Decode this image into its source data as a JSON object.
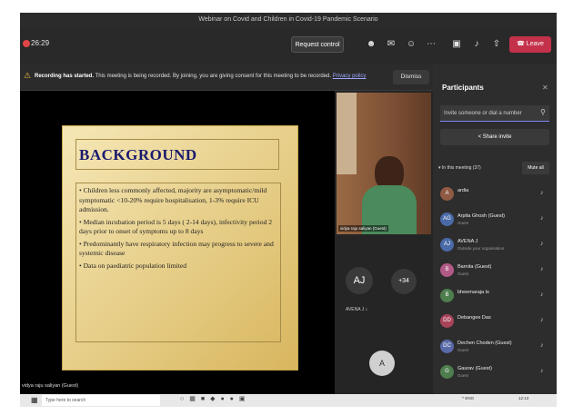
{
  "window": {
    "title": "Webinar on Covid and Children in Covid-19 Pandemic Scenario"
  },
  "toolbar": {
    "timer": "26:29",
    "request_control": "Request control",
    "icons": [
      "people-icon",
      "chat-icon",
      "reactions-icon",
      "more-icon",
      "camera-icon",
      "mic-icon",
      "share-icon"
    ],
    "leave_label": "Leave",
    "leave_color": "#c4314b"
  },
  "banner": {
    "bold": "Recording has started.",
    "text": "This meeting is being recorded. By joining, you are giving consent for this meeting to be recorded.",
    "link": "Privacy policy",
    "dismiss": "Dismiss"
  },
  "slide": {
    "title": "BACKGROUND",
    "bullets": [
      "Children less commonly affected, majority are asymptomatic/mild symptomatic <10-20% require hospitalisation, 1-3% require ICU admission.",
      "Median incubation period is 5 days ( 2-14 days), infectivity period 2 days prior to onset of symptoms up to 8 days",
      "Predominantly have respiratory infection may progress to severe and systemic disease",
      "Data on paediatric population limited"
    ],
    "presenter": "vidya raju saliyan (Guest)"
  },
  "gallery": {
    "camera_name": "vidya raju saliyan (Guest)",
    "aj_initials": "AJ",
    "aj_name": "AVENA J",
    "more_count": "+34",
    "a_initial": "A"
  },
  "participants": {
    "title": "Participants",
    "invite_placeholder": "Invite someone or dial a number",
    "share_invite": "Share invite",
    "section_label": "In this meeting (37)",
    "mute_all": "Mute all",
    "list": [
      {
        "initials": "A",
        "name": "ardia",
        "sub": "",
        "color": "#8f5a44"
      },
      {
        "initials": "AG",
        "name": "Arpita Ghosh (Guest)",
        "sub": "Guest",
        "color": "#4a6aa8"
      },
      {
        "initials": "AJ",
        "name": "AVENA J",
        "sub": "Outside your organisation",
        "color": "#4a6aa8"
      },
      {
        "initials": "B",
        "name": "Barnita (Guest)",
        "sub": "Guest",
        "color": "#b25a86"
      },
      {
        "initials": "B",
        "name": "bheemaraja ts",
        "sub": "",
        "color": "#4e7e4e"
      },
      {
        "initials": "DD",
        "name": "Debangee Das",
        "sub": "",
        "color": "#a8445a"
      },
      {
        "initials": "DC",
        "name": "Dechen Choden (Guest)",
        "sub": "Guest",
        "color": "#5a6aa8"
      },
      {
        "initials": "G",
        "name": "Gaurav (Guest)",
        "sub": "Guest",
        "color": "#4e7e4e"
      }
    ]
  },
  "taskbar": {
    "search_placeholder": "Type here to search",
    "tray": "^ ENG",
    "clock": "12:13"
  }
}
